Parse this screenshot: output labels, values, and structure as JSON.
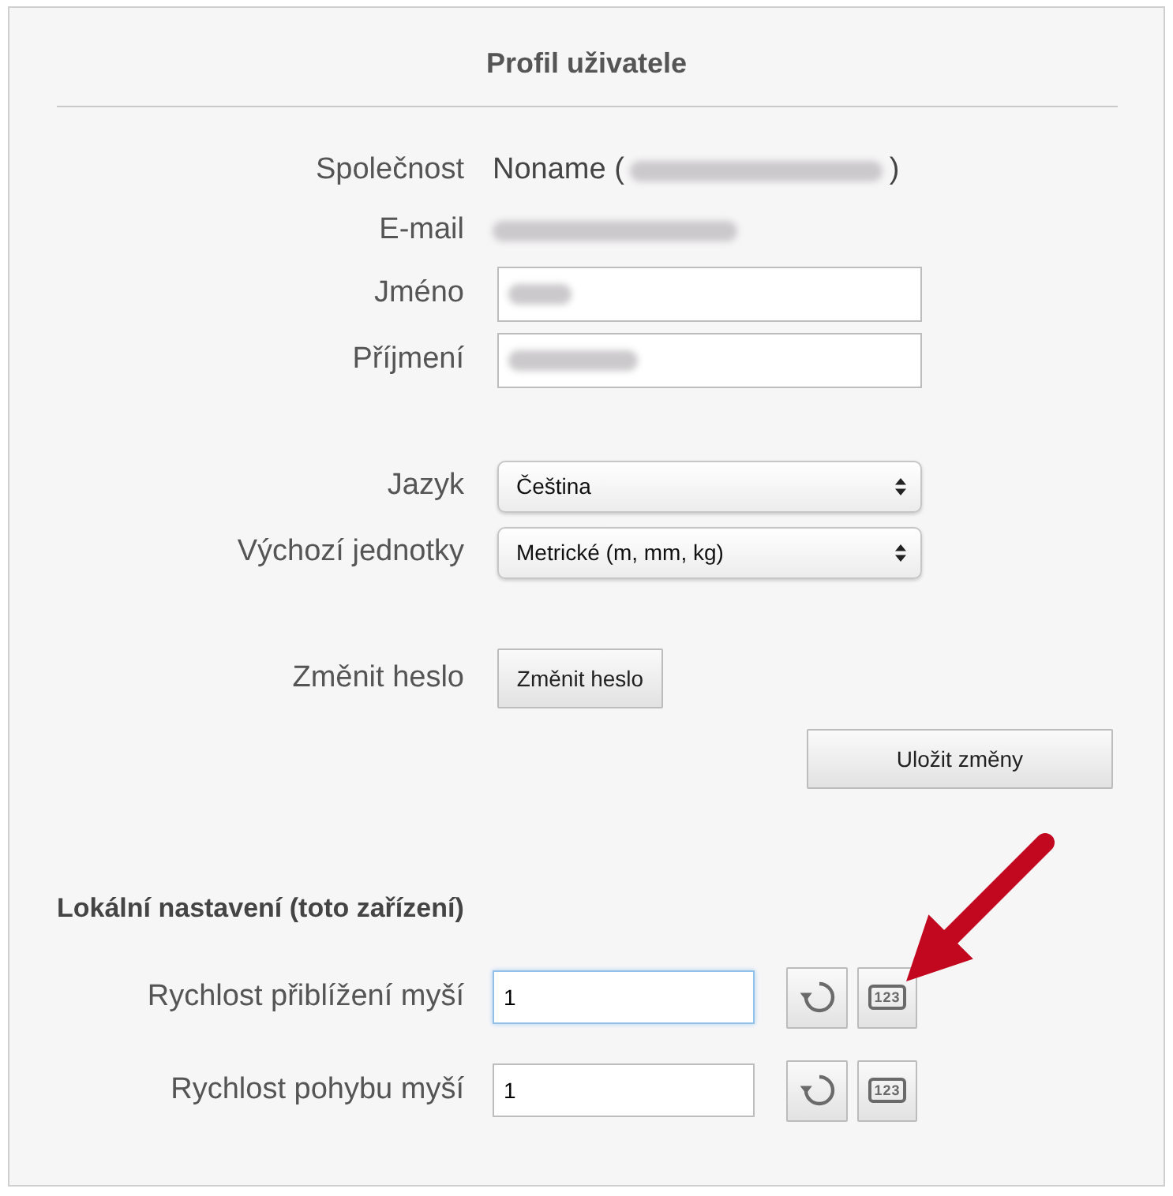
{
  "profile": {
    "title": "Profil uživatele",
    "groups": [
      {
        "fields": [
          {
            "kind": "text",
            "label": "Společnost",
            "value": "Noname (",
            "blurred": true,
            "value_end": ")"
          },
          {
            "kind": "text",
            "label": "E-mail",
            "blurred": true
          },
          {
            "kind": "input",
            "label": "Jméno",
            "blurred": true
          },
          {
            "kind": "input",
            "label": "Příjmení",
            "blurred": true
          }
        ]
      },
      {
        "fields": [
          {
            "kind": "select",
            "label": "Jazyk",
            "value": "Čeština"
          },
          {
            "kind": "select",
            "label": "Výchozí jednotky",
            "value": "Metrické (m, mm, kg)"
          }
        ]
      },
      {
        "fields": [
          {
            "kind": "button",
            "label": "Změnit heslo",
            "button": "Změnit heslo"
          }
        ]
      }
    ],
    "save_button": "Uložit změny"
  },
  "local_settings": {
    "title": "Lokální nastavení (toto zařízení)",
    "rows": [
      {
        "label": "Rychlost přiblížení myší",
        "value": "1",
        "focused": true,
        "buttons": [
          {
            "kind": "reset"
          },
          {
            "kind": "numeric",
            "label": "123"
          }
        ]
      },
      {
        "label": "Rychlost pohybu myší",
        "value": "1",
        "focused": false,
        "buttons": [
          {
            "kind": "reset"
          },
          {
            "kind": "numeric",
            "label": "123"
          }
        ]
      }
    ]
  },
  "annotation": {
    "kind": "arrow"
  }
}
